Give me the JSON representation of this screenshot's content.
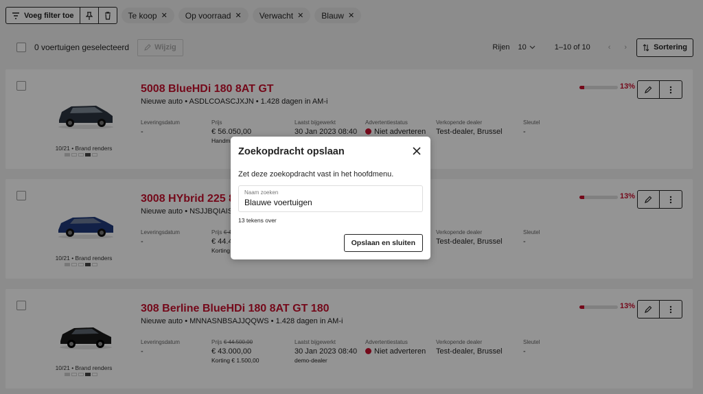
{
  "filters": {
    "add_filter_label": "Voeg filter toe",
    "chips": [
      "Te koop",
      "Op voorraad",
      "Verwacht",
      "Blauw"
    ]
  },
  "toolbar": {
    "selected_label": "0 voertuigen geselecteerd",
    "edit_label": "Wijzig",
    "rows_label": "Rijen",
    "rows_value": "10",
    "range_label": "1–10 of 10",
    "sort_label": "Sortering"
  },
  "cards": [
    {
      "title": "5008 BlueHDi 180 8AT GT",
      "subtitle": "Nieuwe auto • ASDLCOASCJXJN • 1.428 dagen in AM-i",
      "render_label": "10/21 • Brand renders",
      "progress_pct": "13%",
      "progress_value": 0.13,
      "fields": {
        "delivery": {
          "label": "Leveringsdatum",
          "value": "-"
        },
        "price": {
          "label": "Prijs",
          "value": "€ 56.050,00",
          "note": "Handm"
        },
        "updated": {
          "label": "Laatst bijgewerkt",
          "value": "30 Jan 2023 08:40"
        },
        "ad_status": {
          "label": "Advertentiestatus",
          "value": "Niet adverteren"
        },
        "dealer": {
          "label": "Verkopende dealer",
          "value": "Test-dealer, Brussel"
        },
        "key": {
          "label": "Sleutel",
          "value": "-"
        }
      }
    },
    {
      "title": "3008 HYbrid 225 8",
      "subtitle": "Nieuwe auto • NSJJBQIAISDN",
      "render_label": "10/21 • Brand renders",
      "progress_pct": "13%",
      "progress_value": 0.13,
      "fields": {
        "delivery": {
          "label": "Leveringsdatum",
          "value": "-"
        },
        "price": {
          "label": "Prijs",
          "old": "€ 4",
          "value": "€ 44.4",
          "note": "Korting"
        },
        "updated": {
          "label": "",
          "value": ""
        },
        "ad_status": {
          "label": "",
          "value": ""
        },
        "dealer": {
          "label": "Verkopende dealer",
          "value": "Test-dealer, Brussel"
        },
        "key": {
          "label": "Sleutel",
          "value": "-"
        }
      }
    },
    {
      "title": "308 Berline BlueHDi 180 8AT GT 180",
      "subtitle": "Nieuwe auto • MNNASNBSAJJQQWS • 1.428 dagen in AM-i",
      "render_label": "10/21 • Brand renders",
      "progress_pct": "13%",
      "progress_value": 0.13,
      "fields": {
        "delivery": {
          "label": "Leveringsdatum",
          "value": "-"
        },
        "price": {
          "label": "Prijs",
          "old": "€ 44.500,00",
          "value": "€ 43.000,00",
          "note": "Korting € 1.500,00"
        },
        "updated": {
          "label": "Laatst bijgewerkt",
          "value": "30 Jan 2023 08:40",
          "note": "demo-dealer"
        },
        "ad_status": {
          "label": "Advertentiestatus",
          "value": "Niet adverteren"
        },
        "dealer": {
          "label": "Verkopende dealer",
          "value": "Test-dealer, Brussel"
        },
        "key": {
          "label": "Sleutel",
          "value": "-"
        }
      }
    }
  ],
  "modal": {
    "title": "Zoekopdracht opslaan",
    "description": "Zet deze zoekopdracht vast in het hoofdmenu.",
    "input_label": "Naam zoeken",
    "input_value": "Blauwe voertuigen",
    "char_count": "13 tekens over",
    "save_label": "Opslaan en sluiten"
  },
  "colors": {
    "accent": "#c8102e",
    "car_color_1": "#2b3440",
    "car_color_2": "#1f3a7a",
    "car_color_3": "#1a1a1a"
  }
}
